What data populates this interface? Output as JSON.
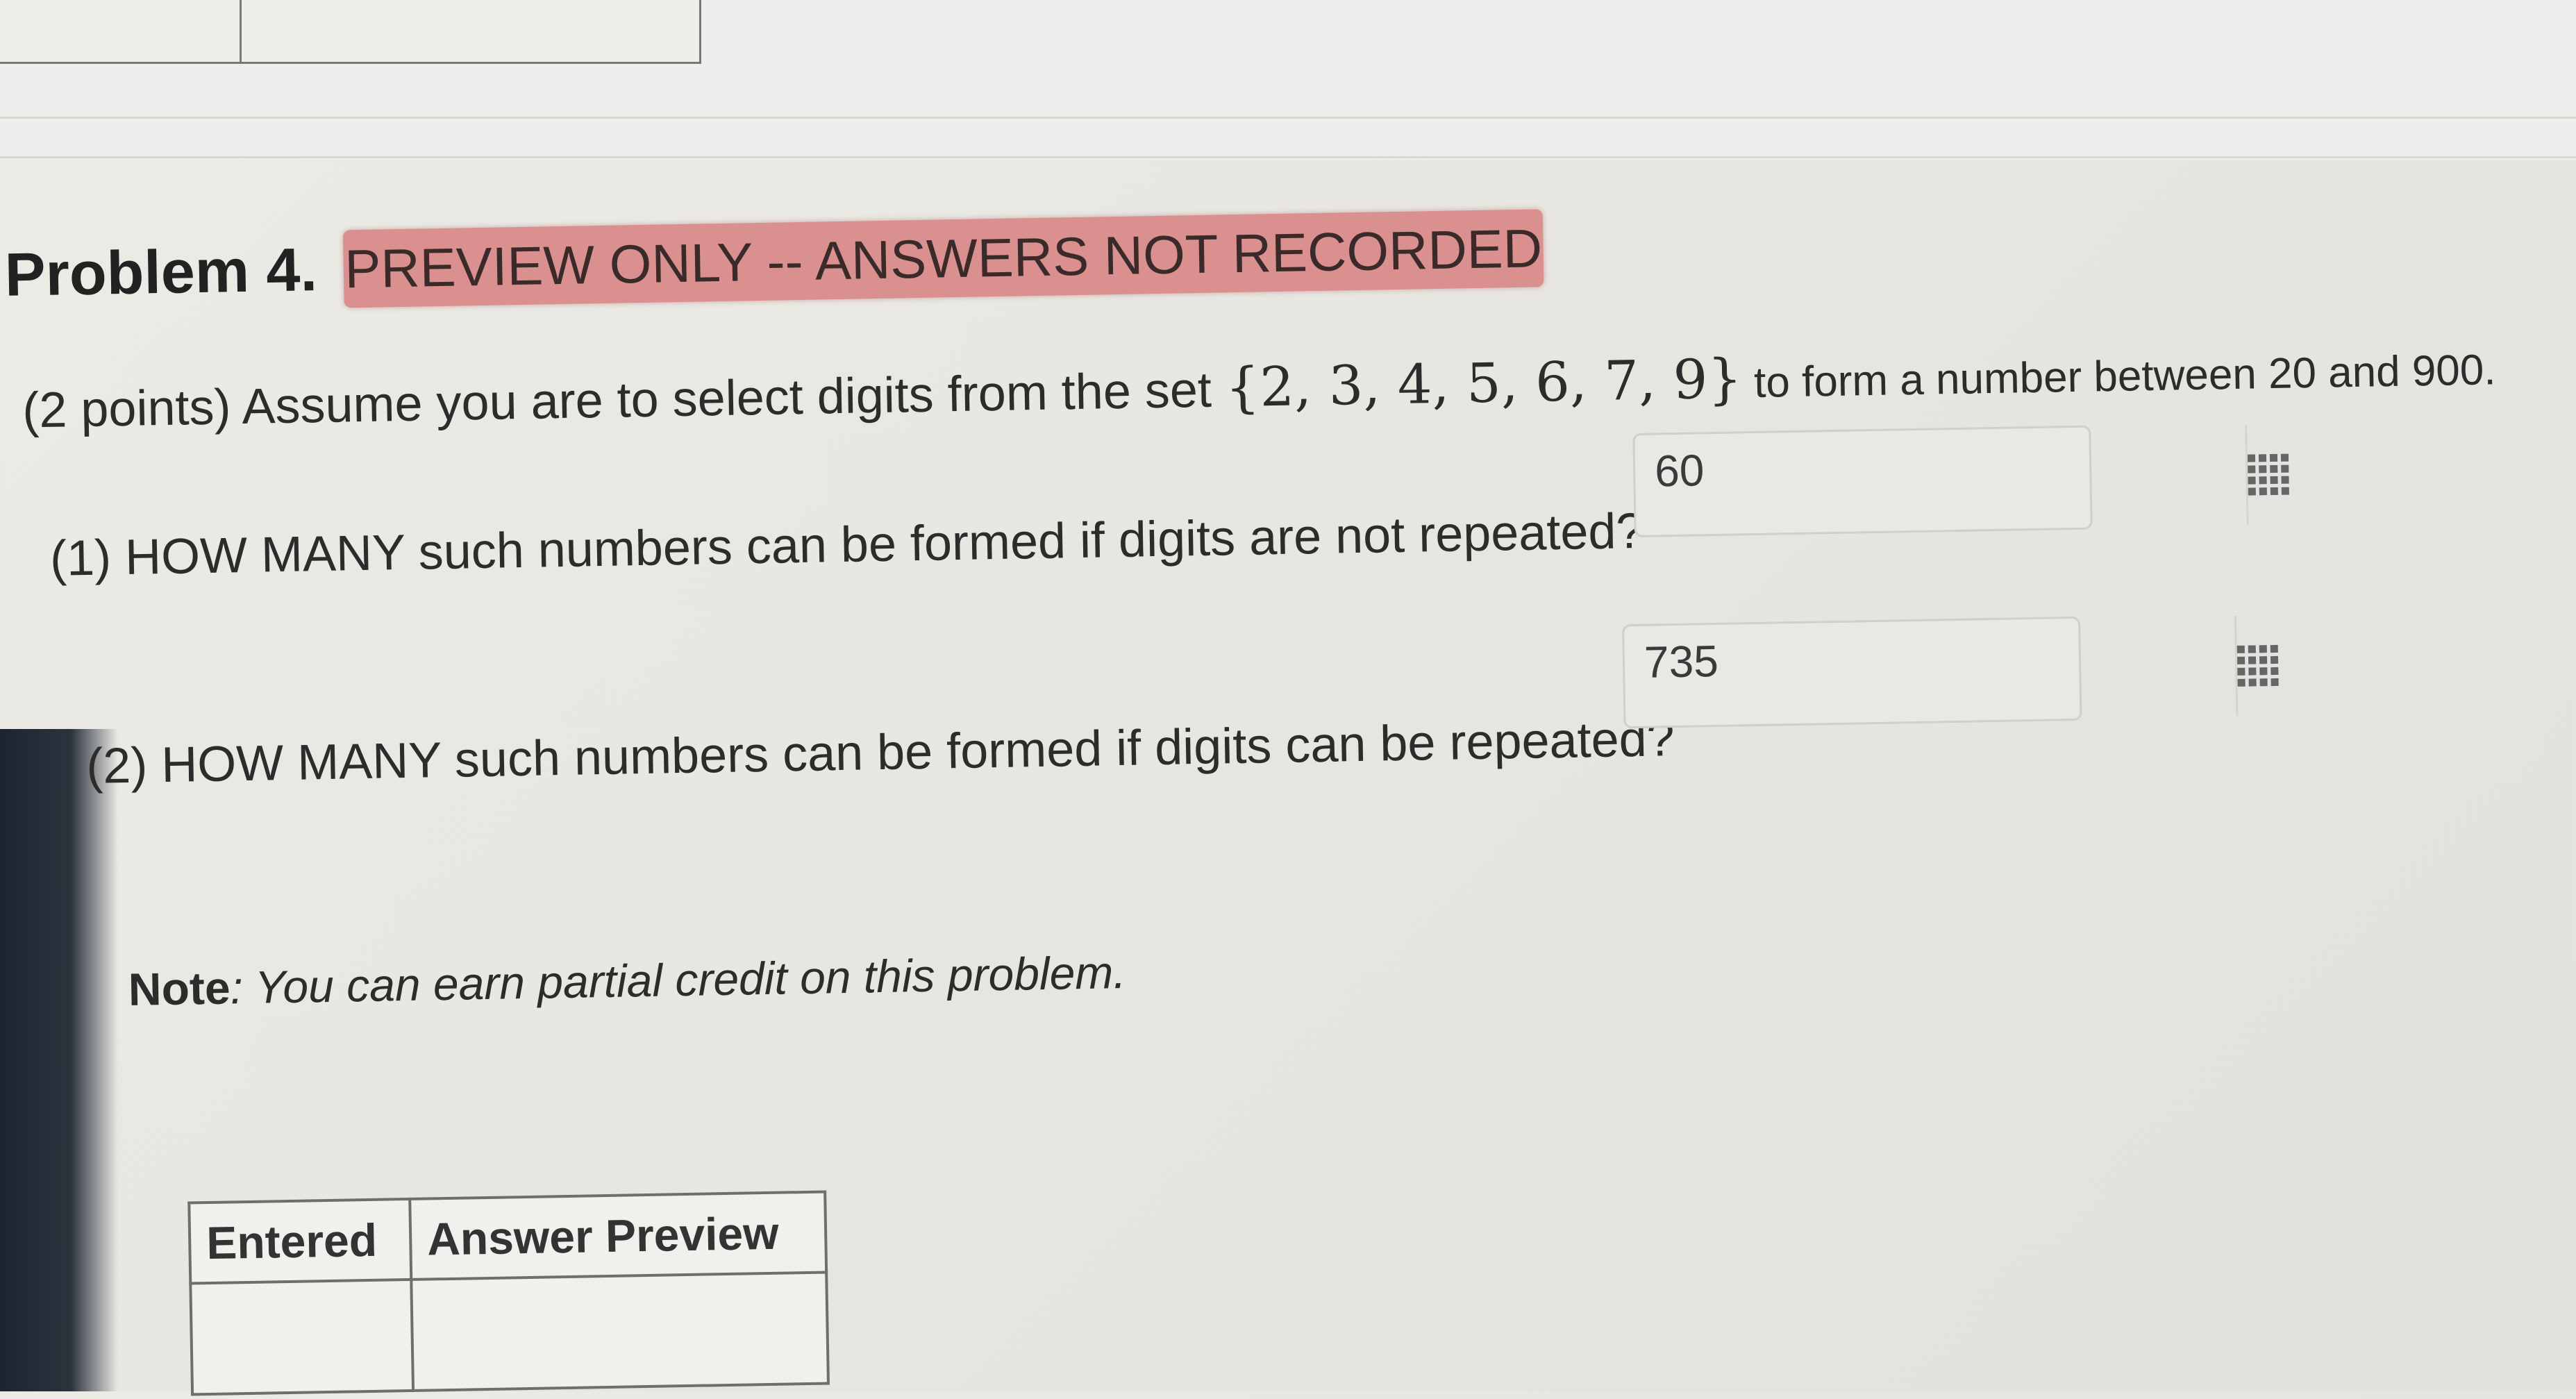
{
  "problem": {
    "title": "Problem 4.",
    "preview_badge": "PREVIEW ONLY -- ANSWERS NOT RECORDED",
    "statement_prefix": "(2 points) Assume you are to select digits from the set ",
    "statement_set": "{2, 3, 4, 5, 6, 7, 9}",
    "statement_suffix": " to form a number between 20 and 900."
  },
  "questions": [
    {
      "label": "(1) HOW MANY such numbers can be formed if digits are not repeated?",
      "answer": "60",
      "icon": "grid-icon"
    },
    {
      "label": "(2) HOW MANY such numbers can be formed if digits can be repeated?",
      "answer": "735",
      "icon": "grid-icon"
    }
  ],
  "note": {
    "label": "Note",
    "text": ": You can earn partial credit on this problem."
  },
  "results_table": {
    "headers": [
      "Entered",
      "Answer Preview"
    ],
    "rows": [
      [
        "",
        ""
      ]
    ]
  }
}
